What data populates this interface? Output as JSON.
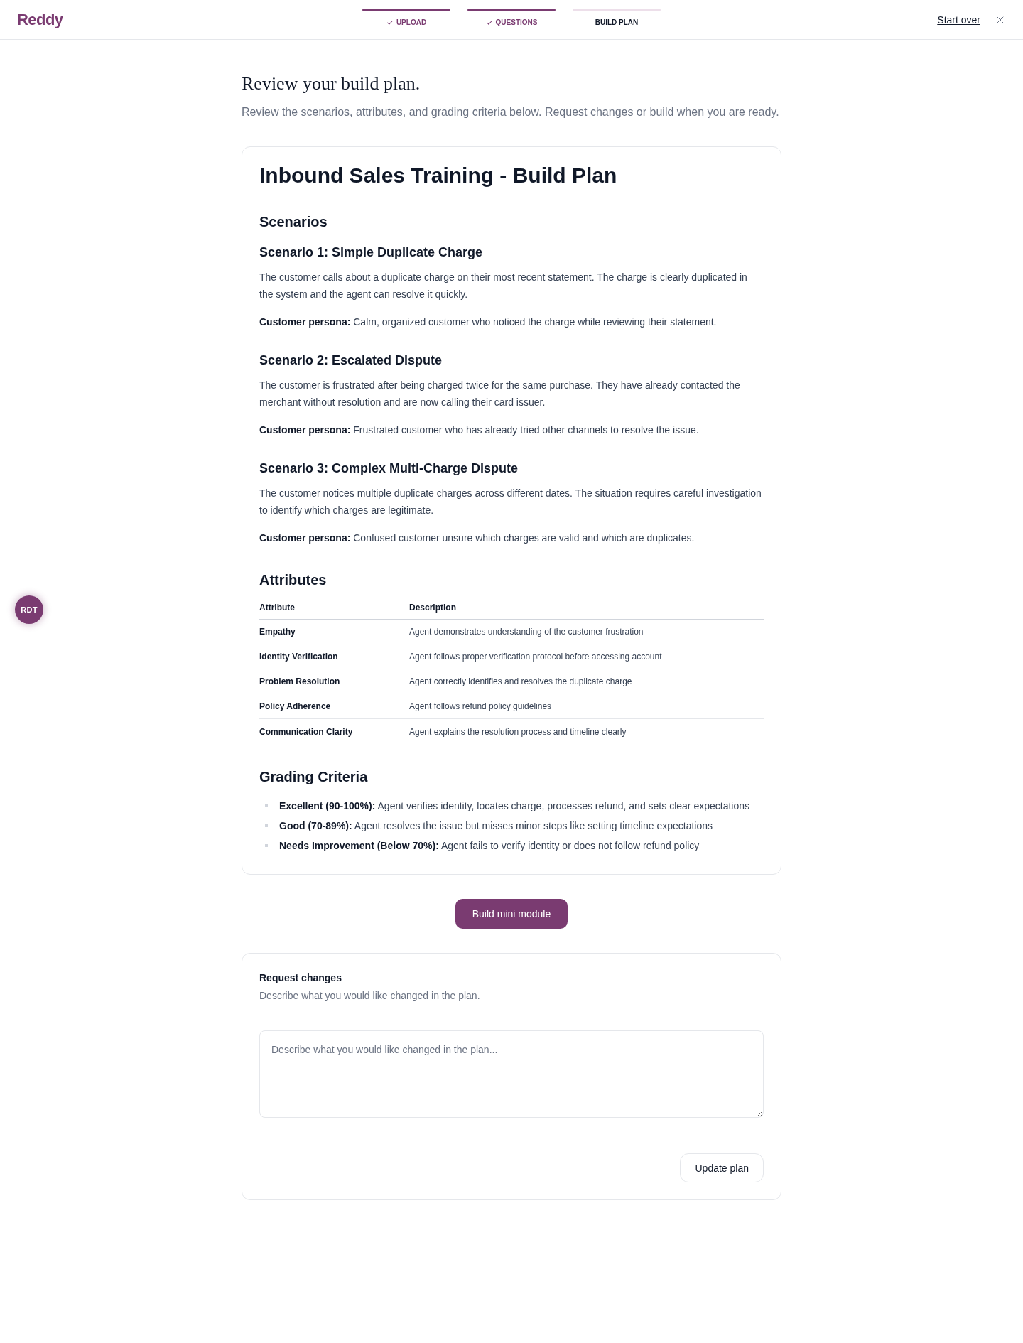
{
  "header": {
    "logo": "Reddy",
    "steps": [
      {
        "label": "UPLOAD",
        "completed": true,
        "selected": false
      },
      {
        "label": "QUESTIONS",
        "completed": true,
        "selected": false
      },
      {
        "label": "BUILD PLAN",
        "completed": false,
        "selected": true
      }
    ],
    "start_over": "Start over"
  },
  "intro": {
    "title": "Review your build plan.",
    "subtitle": "Review the scenarios, attributes, and grading criteria below. Request changes or build when you are ready."
  },
  "plan": {
    "title": "Inbound Sales Training - Build Plan",
    "scenarios_heading": "Scenarios",
    "scenarios": [
      {
        "title": "Scenario 1: Simple Duplicate Charge",
        "description": "The customer calls about a duplicate charge on their most recent statement. The charge is clearly duplicated in the system and the agent can resolve it quickly.",
        "persona": "**Customer persona:** Calm, organized customer who noticed the charge while reviewing their statement."
      },
      {
        "title": "Scenario 2: Escalated Dispute",
        "description": "The customer is frustrated after being charged twice for the same purchase. They have already contacted the merchant without resolution and are now calling their card issuer.",
        "persona": "**Customer persona:** Frustrated customer who has already tried other channels to resolve the issue."
      },
      {
        "title": "Scenario 3: Complex Multi-Charge Dispute",
        "description": "The customer notices multiple duplicate charges across different dates. The situation requires careful investigation to identify which charges are legitimate.",
        "persona": "**Customer persona:** Confused customer unsure which charges are valid and which are duplicates."
      }
    ],
    "attributes_heading": "Attributes",
    "attributes_table": {
      "columns": [
        "Attribute",
        "Description"
      ],
      "rows": [
        [
          "Empathy",
          "Agent demonstrates understanding of the customer frustration"
        ],
        [
          "Identity Verification",
          "Agent follows proper verification protocol before accessing account"
        ],
        [
          "Problem Resolution",
          "Agent correctly identifies and resolves the duplicate charge"
        ],
        [
          "Policy Adherence",
          "Agent follows refund policy guidelines"
        ],
        [
          "Communication Clarity",
          "Agent explains the resolution process and timeline clearly"
        ]
      ]
    },
    "grading_heading": "Grading Criteria",
    "grading": [
      "**Excellent (90-100%):** Agent verifies identity, locates charge, processes refund, and sets clear expectations",
      "**Good (70-89%):** Agent resolves the issue but misses minor steps like setting timeline expectations",
      "**Needs Improvement (Below 70%):** Agent fails to verify identity or does not follow refund policy"
    ]
  },
  "build_button": "Build mini module",
  "request_changes": {
    "title": "Request changes",
    "subtitle": "Describe what you would like changed in the plan.",
    "placeholder": "Describe what you would like changed in the plan...",
    "button": "Update plan"
  },
  "floating_badge": "RDT"
}
